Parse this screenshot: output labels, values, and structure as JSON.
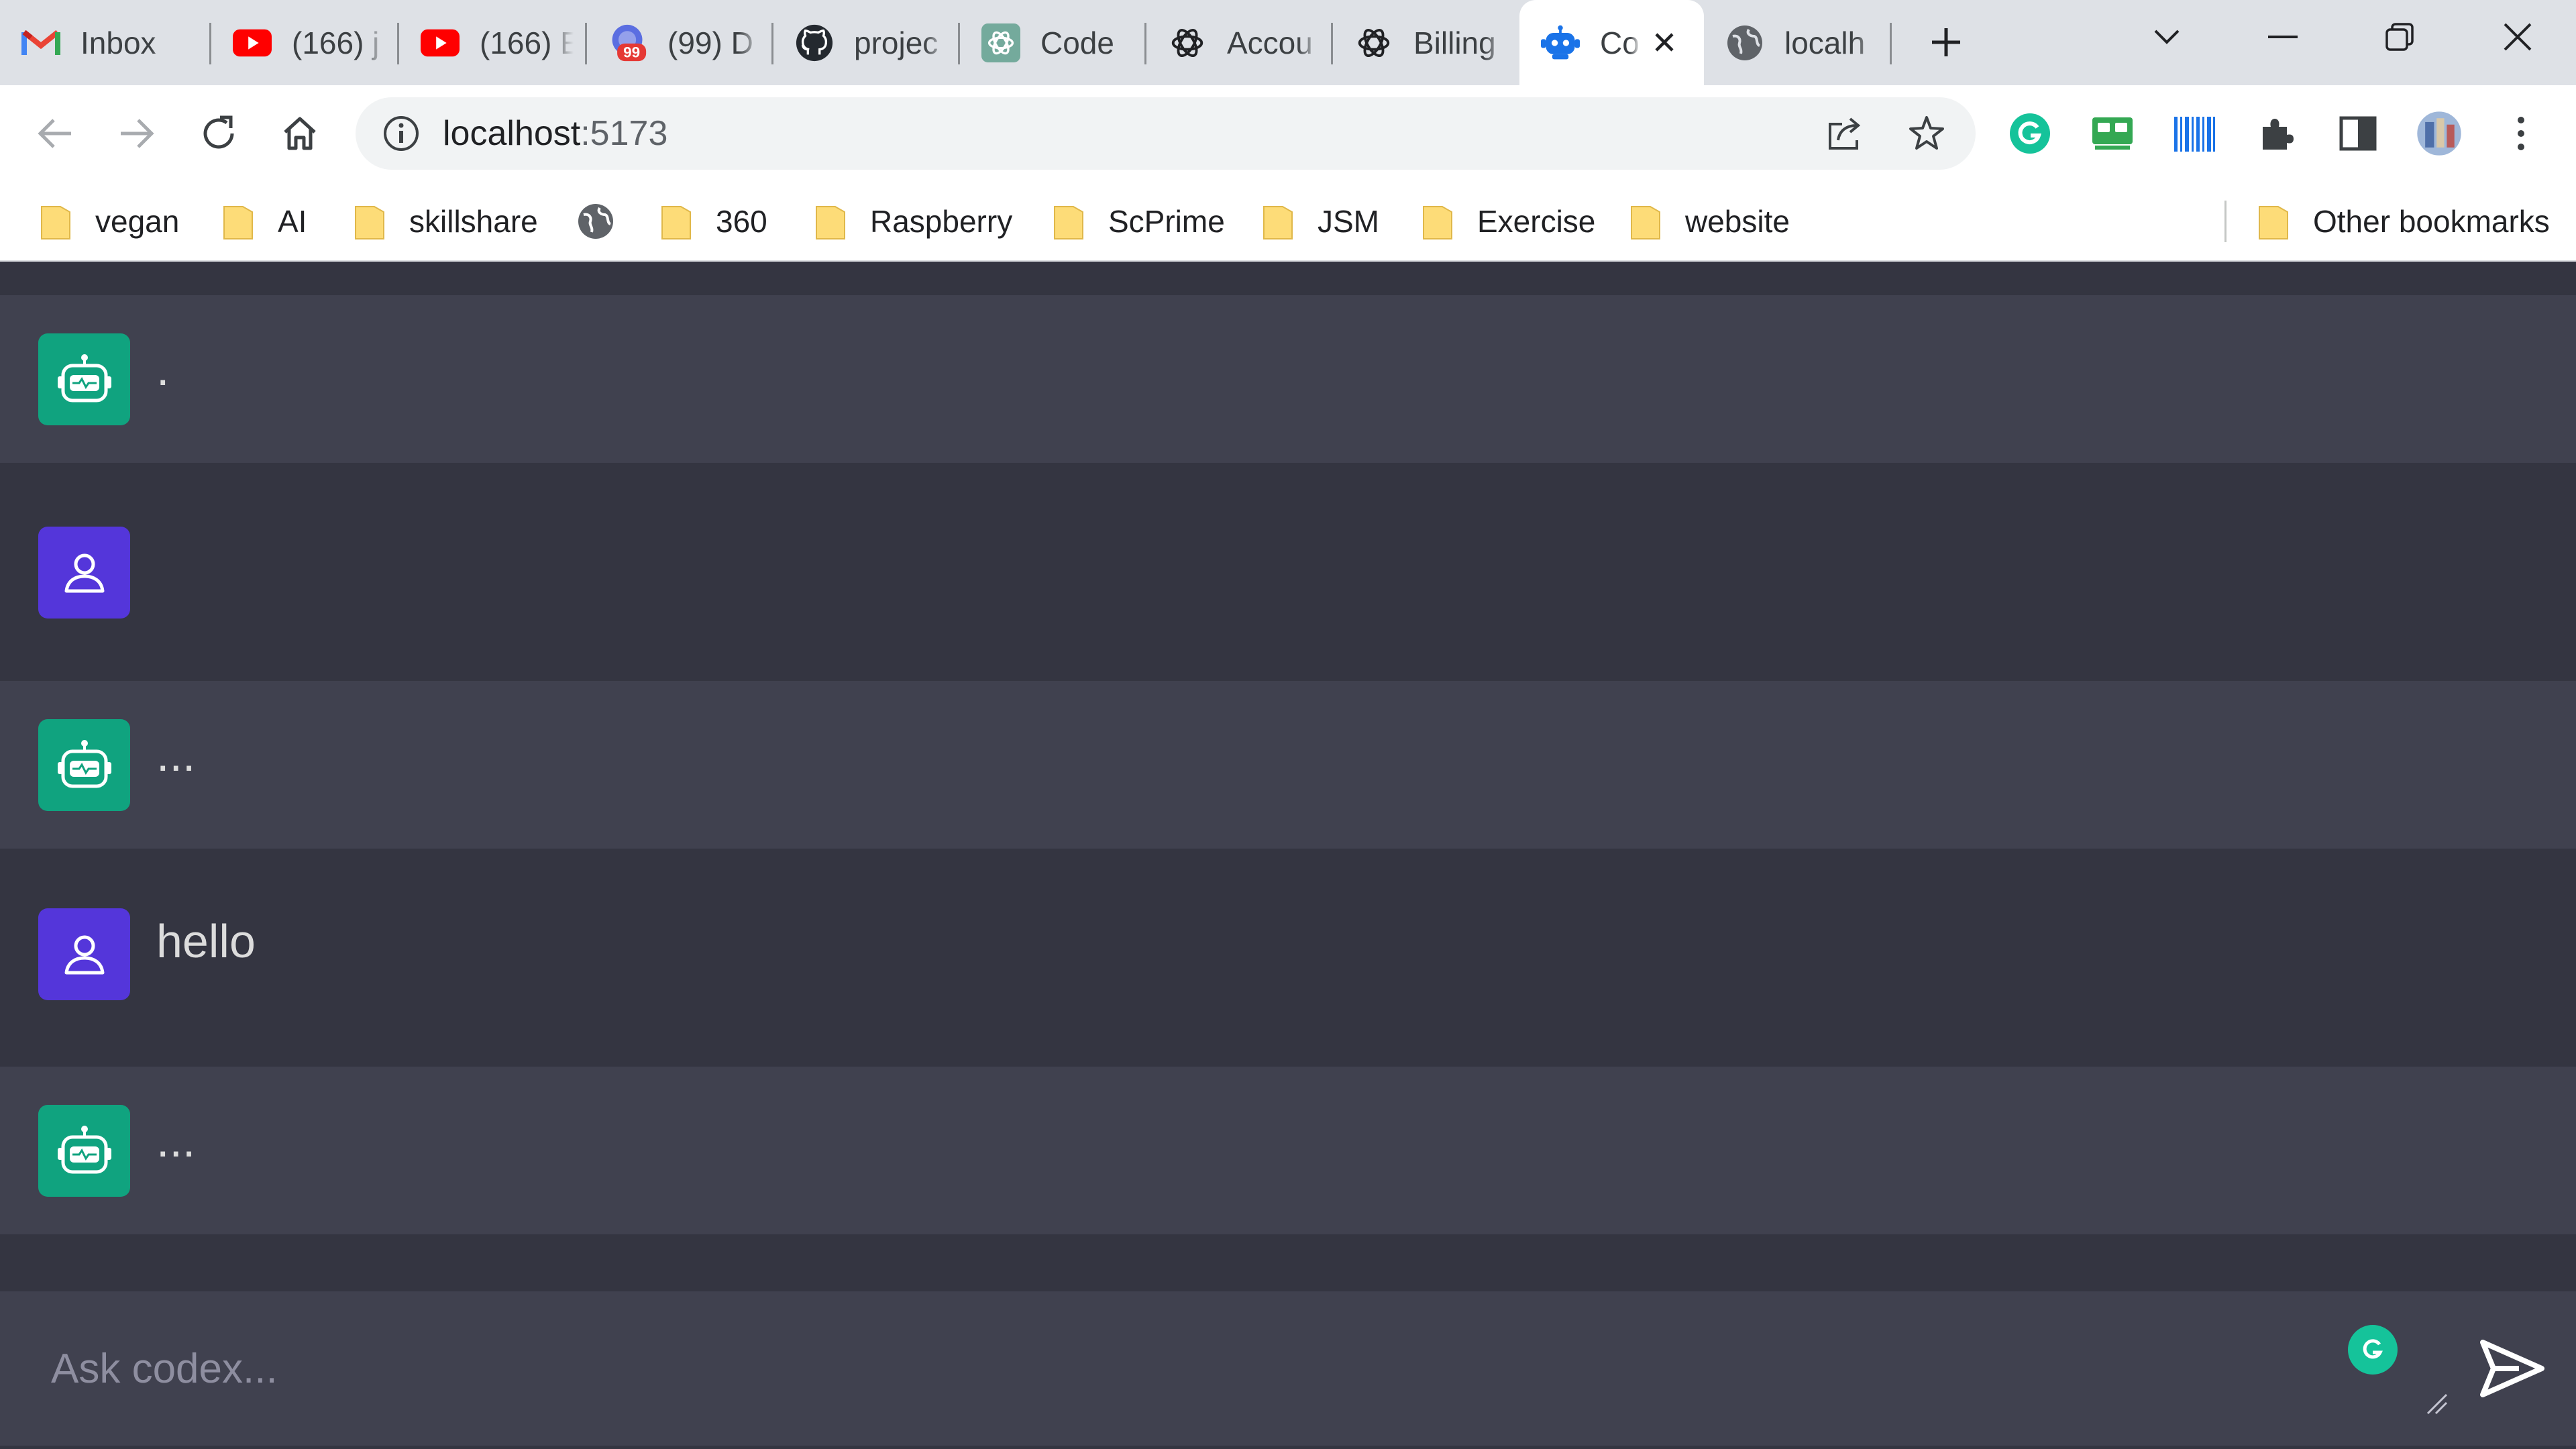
{
  "browser": {
    "tabs": [
      {
        "title": "Inbox",
        "icon": "gmail-icon"
      },
      {
        "title": "(166) j",
        "icon": "youtube-icon"
      },
      {
        "title": "(166) E",
        "icon": "youtube-icon"
      },
      {
        "title": "(99) D",
        "icon": "notification-badge-icon",
        "badge": "99"
      },
      {
        "title": "projec",
        "icon": "github-icon"
      },
      {
        "title": "Code",
        "icon": "openai-icon"
      },
      {
        "title": "Accou",
        "icon": "openai-icon"
      },
      {
        "title": "Billing",
        "icon": "openai-icon"
      },
      {
        "title": "Co",
        "icon": "robot-icon",
        "active": true
      },
      {
        "title": "localh",
        "icon": "globe-icon"
      }
    ],
    "address": {
      "host": "localhost",
      "port": ":5173"
    },
    "bookmarks": [
      "vegan",
      "AI",
      "skillshare",
      "360",
      "Raspberry",
      "ScPrime",
      "JSM",
      "Exercise",
      "website"
    ],
    "other_bookmarks": "Other bookmarks",
    "accent": "#1a73e8"
  },
  "chat": {
    "messages": [
      {
        "role": "ai",
        "text": "."
      },
      {
        "role": "user",
        "text": ""
      },
      {
        "role": "ai",
        "text": "..."
      },
      {
        "role": "user",
        "text": "hello"
      },
      {
        "role": "ai",
        "text": "..."
      }
    ],
    "input": {
      "placeholder": "Ask codex...",
      "value": ""
    },
    "colors": {
      "ai_avatar": "#10a37f",
      "user_avatar": "#5436da",
      "ai_row": "#40414f",
      "user_row": "#343541"
    }
  }
}
